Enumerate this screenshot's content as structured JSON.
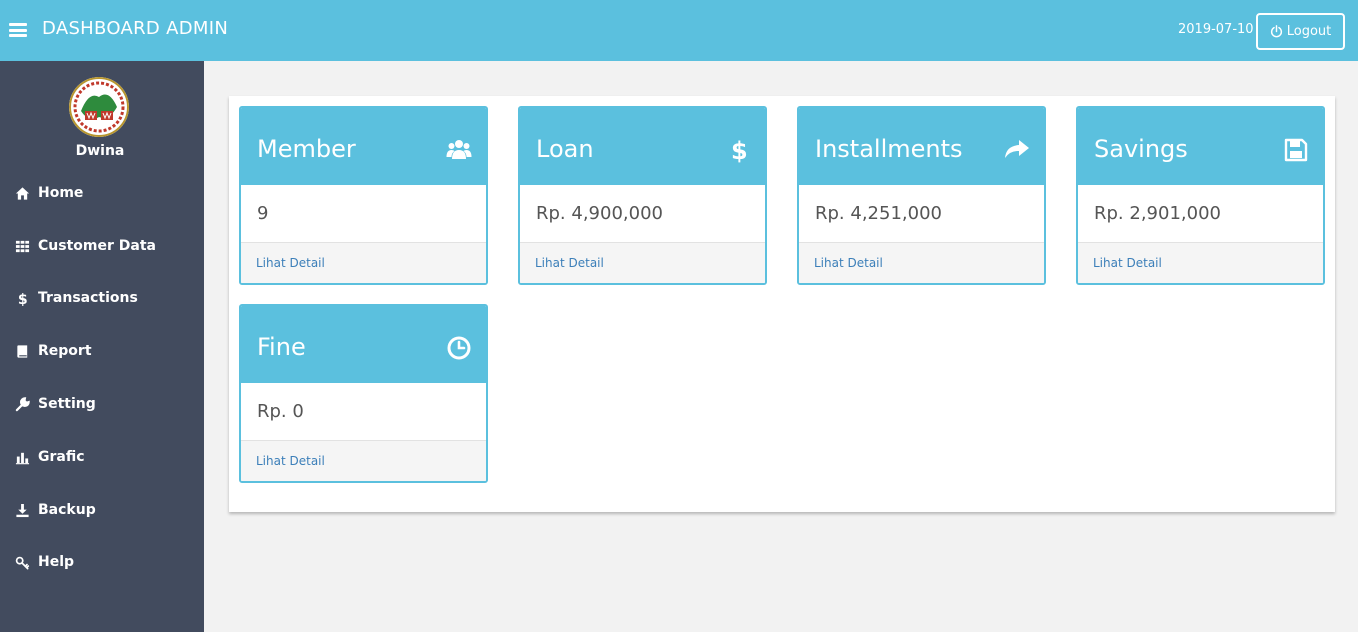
{
  "header": {
    "brand": "DASHBOARD ADMIN",
    "date": "2019-07-10",
    "logout_label": "Logout"
  },
  "sidebar": {
    "username": "Dwina",
    "items": [
      {
        "label": "Home",
        "icon": "home-icon"
      },
      {
        "label": "Customer Data",
        "icon": "grid-icon"
      },
      {
        "label": "Transactions",
        "icon": "dollar-icon"
      },
      {
        "label": "Report",
        "icon": "book-icon"
      },
      {
        "label": "Setting",
        "icon": "wrench-icon"
      },
      {
        "label": "Grafic",
        "icon": "bar-chart-icon"
      },
      {
        "label": "Backup",
        "icon": "download-icon"
      },
      {
        "label": "Help",
        "icon": "key-icon"
      }
    ]
  },
  "cards": [
    {
      "title": "Member",
      "value": "9",
      "link": "Lihat Detail",
      "icon": "users-icon"
    },
    {
      "title": "Loan",
      "value": "Rp. 4,900,000",
      "link": "Lihat Detail",
      "icon": "dollar-icon"
    },
    {
      "title": "Installments",
      "value": "Rp. 4,251,000",
      "link": "Lihat Detail",
      "icon": "share-arrow-icon"
    },
    {
      "title": "Savings",
      "value": "Rp. 2,901,000",
      "link": "Lihat Detail",
      "icon": "floppy-disk-icon"
    },
    {
      "title": "Fine",
      "value": "Rp. 0",
      "link": "Lihat Detail",
      "icon": "clock-icon"
    }
  ],
  "colors": {
    "accent": "#5bc0de",
    "sidebar_bg": "#424b5e",
    "page_bg": "#f2f2f2",
    "link": "#3c7fb9"
  }
}
